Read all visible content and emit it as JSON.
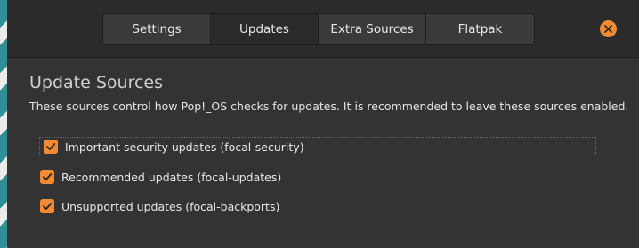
{
  "tabs": [
    {
      "label": "Settings",
      "active": false
    },
    {
      "label": "Updates",
      "active": true
    },
    {
      "label": "Extra Sources",
      "active": false
    },
    {
      "label": "Flatpak",
      "active": false
    }
  ],
  "close_icon": "close-icon",
  "section": {
    "title": "Update Sources",
    "description": "These sources control how Pop!_OS checks for updates. It is recommended to leave these sources enabled."
  },
  "sources": [
    {
      "label": "Important security updates (focal-security)",
      "checked": true
    },
    {
      "label": "Recommended updates (focal-updates)",
      "checked": true
    },
    {
      "label": "Unsupported updates (focal-backports)",
      "checked": true
    }
  ],
  "colors": {
    "accent": "#f28b33",
    "window_bg": "#333333",
    "headerbar_bg": "#2b2b2b"
  }
}
